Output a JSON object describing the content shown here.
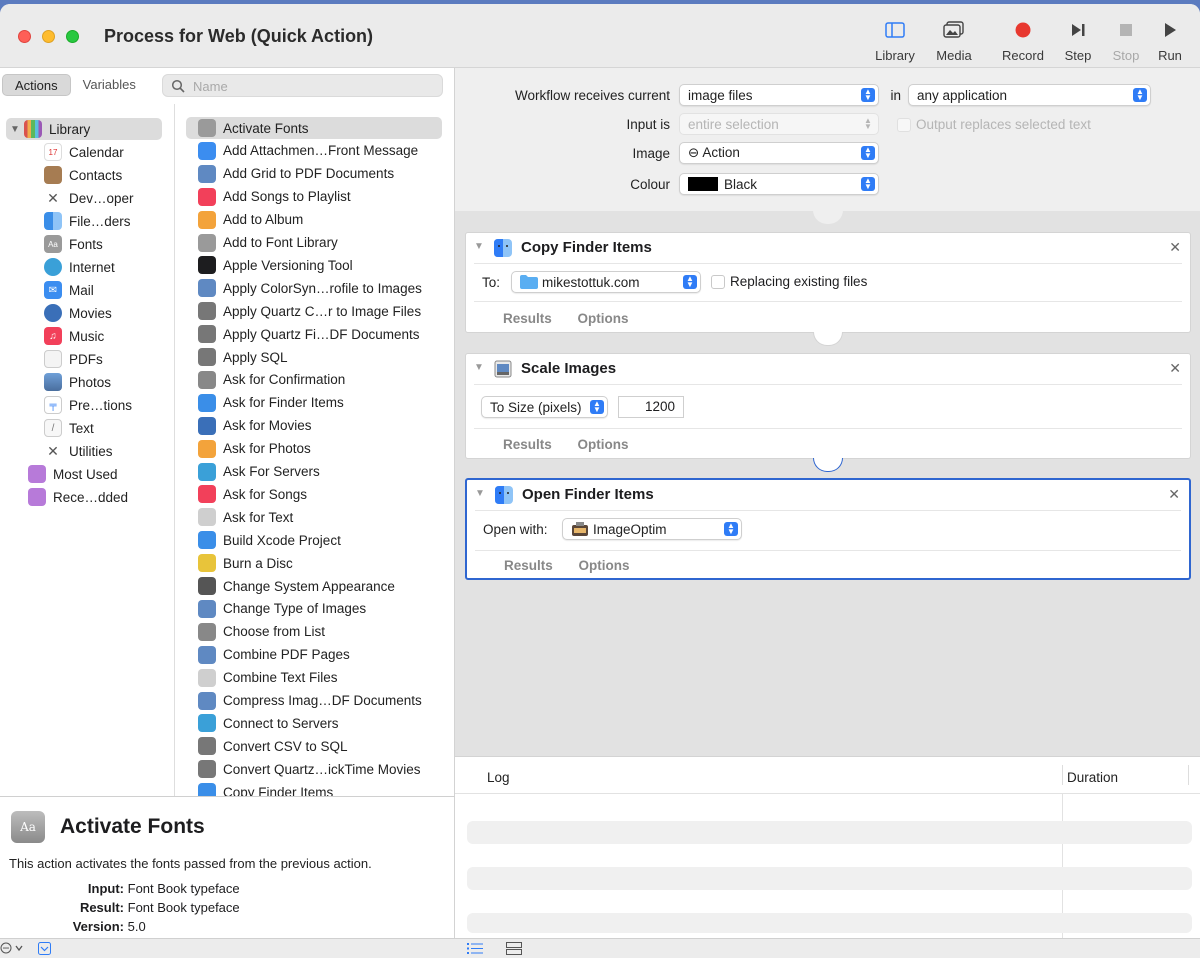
{
  "window": {
    "title": "Process for Web (Quick Action)"
  },
  "toolbar": {
    "library_label": "Library",
    "media_label": "Media",
    "record_label": "Record",
    "step_label": "Step",
    "stop_label": "Stop",
    "run_label": "Run"
  },
  "left_tabs": {
    "actions": "Actions",
    "variables": "Variables"
  },
  "search": {
    "placeholder": "Name"
  },
  "library": {
    "root": "Library",
    "items": [
      "Calendar",
      "Contacts",
      "Dev…oper",
      "File…ders",
      "Fonts",
      "Internet",
      "Mail",
      "Movies",
      "Music",
      "PDFs",
      "Photos",
      "Pre…tions",
      "Text",
      "Utilities"
    ],
    "most_used": "Most Used",
    "recently_added": "Rece…dded"
  },
  "actions": [
    "Activate Fonts",
    "Add Attachmen…Front Message",
    "Add Grid to PDF Documents",
    "Add Songs to Playlist",
    "Add to Album",
    "Add to Font Library",
    "Apple Versioning Tool",
    "Apply ColorSyn…rofile to Images",
    "Apply Quartz C…r to Image Files",
    "Apply Quartz Fi…DF Documents",
    "Apply SQL",
    "Ask for Confirmation",
    "Ask for Finder Items",
    "Ask for Movies",
    "Ask for Photos",
    "Ask For Servers",
    "Ask for Songs",
    "Ask for Text",
    "Build Xcode Project",
    "Burn a Disc",
    "Change System Appearance",
    "Change Type of Images",
    "Choose from List",
    "Combine PDF Pages",
    "Combine Text Files",
    "Compress Imag…DF Documents",
    "Connect to Servers",
    "Convert CSV to SQL",
    "Convert Quartz…ickTime Movies",
    "Copy Finder Items"
  ],
  "description": {
    "title": "Activate Fonts",
    "text": "This action activates the fonts passed from the previous action.",
    "input_label": "Input:",
    "input_value": "Font Book typeface",
    "result_label": "Result:",
    "result_value": "Font Book typeface",
    "version_label": "Version:",
    "version_value": "5.0"
  },
  "workflow_header": {
    "receives_label": "Workflow receives current",
    "receives_value": "image files",
    "in_label": "in",
    "app_value": "any application",
    "input_is_label": "Input is",
    "input_is_value": "entire selection",
    "output_replaces": "Output replaces selected text",
    "image_label": "Image",
    "image_value": "⊖ Action",
    "colour_label": "Colour",
    "colour_value": "Black",
    "colour_swatch": "#000000"
  },
  "cards": {
    "copy": {
      "title": "Copy Finder Items",
      "to_label": "To:",
      "to_value": "mikestottuk.com",
      "replacing": "Replacing existing files",
      "results": "Results",
      "options": "Options"
    },
    "scale": {
      "title": "Scale Images",
      "mode": "To Size (pixels)",
      "size": "1200",
      "results": "Results",
      "options": "Options"
    },
    "open": {
      "title": "Open Finder Items",
      "open_with_label": "Open with:",
      "open_with_value": "ImageOptim",
      "results": "Results",
      "options": "Options"
    }
  },
  "log": {
    "log_col": "Log",
    "duration_col": "Duration"
  },
  "colors": {
    "accent": "#2f7cf6",
    "focus_border": "#2f66d0"
  }
}
